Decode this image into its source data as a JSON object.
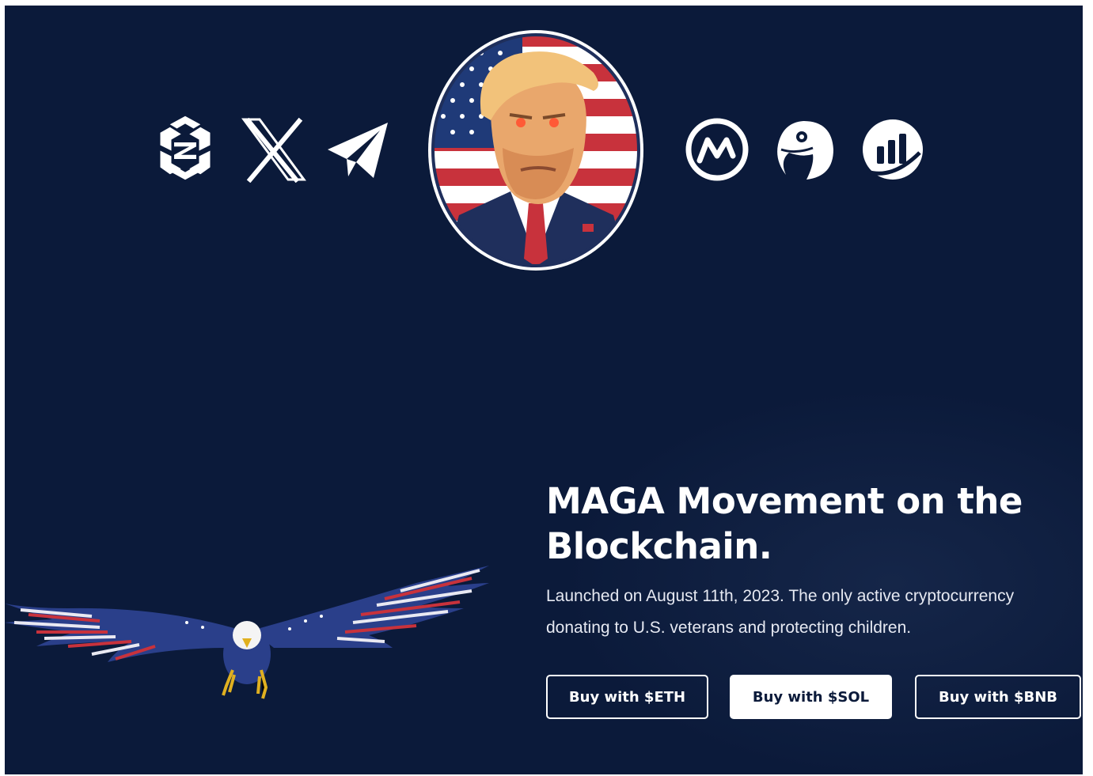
{
  "social_links": [
    {
      "name": "dextools-icon"
    },
    {
      "name": "x-icon"
    },
    {
      "name": "telegram-icon"
    },
    {
      "name": "coinmarketcap-icon"
    },
    {
      "name": "coingecko-icon"
    },
    {
      "name": "dexscreener-icon"
    }
  ],
  "hero": {
    "headline_line1": "MAGA Movement on the",
    "headline_line2": "Blockchain.",
    "subtitle_line1": "Launched on August 11th, 2023. The only active cryptocurrency",
    "subtitle_line2": "donating to U.S. veterans and protecting children."
  },
  "buttons": {
    "eth_label": "Buy with $ETH",
    "sol_label": "Buy with $SOL",
    "bnb_label": "Buy with $BNB"
  },
  "colors": {
    "background": "#0b1a3a",
    "text": "#ffffff",
    "flag_red": "#c8323c",
    "flag_blue": "#1f3a78"
  }
}
